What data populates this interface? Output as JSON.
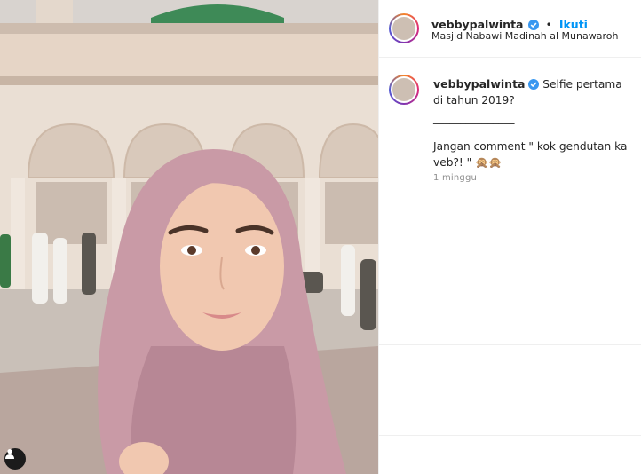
{
  "post": {
    "username": "vebbypalwinta",
    "follow_label": "Ikuti",
    "separator": "•",
    "location": "Masjid Nabawi Madinah al Munawaroh",
    "caption_line1": "Selfie pertama di tahun 2019?",
    "caption_line2": "_______________",
    "caption_line3": "Jangan comment \" kok gendutan ka veb?! \" 🙊🙊",
    "time_ago": "1 minggu"
  },
  "colors": {
    "accent": "#0095f6",
    "verified": "#3897f0",
    "hijab": "#c99aa6",
    "dome": "#3e8a57"
  },
  "icons": {
    "verified": "verified-badge-icon",
    "user_tag": "user-tag-icon"
  }
}
